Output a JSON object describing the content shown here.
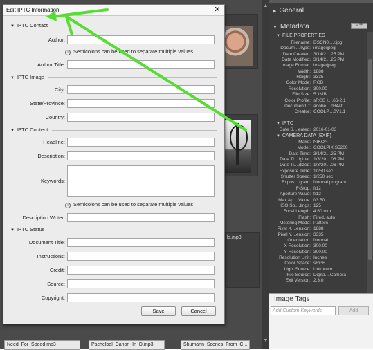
{
  "background": {
    "files": [
      "Need_For_Speed.mp3",
      "Pachelbel_Canon_In_D.mp3",
      "Shumann_Scenes_From_C..."
    ],
    "partial_file": "ls.mp3"
  },
  "panel": {
    "general_header": "General",
    "metadata_header": "Metadata",
    "file_properties_title": "FILE PROPERTIES",
    "file_properties": [
      {
        "k": "Filename:",
        "v": "DSCN0....r.jpg"
      },
      {
        "k": "Docum....Type:",
        "v": "image/jpeg"
      },
      {
        "k": "Date Created:",
        "v": "3/14/2....25 PM"
      },
      {
        "k": "Date Modified:",
        "v": "3/14/2....25 PM"
      },
      {
        "k": "Image Format:",
        "v": "image/jpeg"
      },
      {
        "k": "Width:",
        "v": "1888"
      },
      {
        "k": "Height:",
        "v": "3335"
      },
      {
        "k": "Color Mode:",
        "v": "RGB"
      },
      {
        "k": "Resolution:",
        "v": "300.00"
      },
      {
        "k": "File Size:",
        "v": "5.1MB"
      },
      {
        "k": "Color Profile:",
        "v": "sRGB I....66-2.1"
      },
      {
        "k": "DocumentID:",
        "v": "adobe....d844f"
      },
      {
        "k": "Creator:",
        "v": "COOLP....0V1.1"
      }
    ],
    "iptc_title": "IPTC",
    "iptc_rows": [
      {
        "k": "Date S....eated:",
        "v": "2016-01-03"
      }
    ],
    "camera_title": "CAMERA DATA (EXIF)",
    "camera_rows": [
      {
        "k": "Make:",
        "v": "NIKON"
      },
      {
        "k": "Model:",
        "v": "COOLPIX S5200"
      },
      {
        "k": "Date Time:",
        "v": "3/14/2....25 PM"
      },
      {
        "k": "Date Ti....iginal:",
        "v": "1/3/20....06 PM"
      },
      {
        "k": "Date Ti....itized:",
        "v": "1/3/20....06 PM"
      },
      {
        "k": "Exposure Time:",
        "v": "1/250 sec"
      },
      {
        "k": "Shutter Speed:",
        "v": "1/250 sec"
      },
      {
        "k": "Expos....gram:",
        "v": "Normal program"
      },
      {
        "k": "F-Stop:",
        "v": "f/12"
      },
      {
        "k": "Aperture Value:",
        "v": "f/12"
      },
      {
        "k": "Max Ap....Value:",
        "v": "f/3.50"
      },
      {
        "k": "ISO Sp....tings:",
        "v": "125"
      },
      {
        "k": "Focal Length:",
        "v": "4.60 mm"
      },
      {
        "k": "Flash:",
        "v": "Fired, auto"
      },
      {
        "k": "Metering Mode:",
        "v": "Pattern"
      },
      {
        "k": "Pixel X....ension:",
        "v": "1888"
      },
      {
        "k": "Pixel Y....ension:",
        "v": "3335"
      },
      {
        "k": "Orientation:",
        "v": "Normal"
      },
      {
        "k": "X Resolution:",
        "v": "300.00"
      },
      {
        "k": "Y Resolution:",
        "v": "300.00"
      },
      {
        "k": "Resolution Unit:",
        "v": "Inches"
      },
      {
        "k": "Color Space:",
        "v": "sRGB"
      },
      {
        "k": "Light Source:",
        "v": "Unknown"
      },
      {
        "k": "File Source:",
        "v": "Digita....Camera"
      },
      {
        "k": "Exif Version:",
        "v": "2.3.0"
      }
    ],
    "image_tags_title": "Image Tags",
    "tags_placeholder": "Add Custom Keywords",
    "tags_add": "Add"
  },
  "dialog": {
    "title": "Edit IPTC Information",
    "close": "✕",
    "sections": {
      "contact": "IPTC Contact",
      "image": "IPTC Image",
      "content": "IPTC Content",
      "status": "IPTC Status"
    },
    "labels": {
      "author": "Author:",
      "author_title": "Author Title:",
      "city": "City:",
      "state": "State/Province:",
      "country": "Country:",
      "headline": "Headline:",
      "description": "Description:",
      "keywords": "Keywords:",
      "description_writer": "Description Writer:",
      "document_title": "Document Title:",
      "instructions": "Instructions:",
      "credit": "Credit:",
      "source": "Source:",
      "copyright": "Copyright:"
    },
    "hint": "Semicolons can be used to separate multiple values",
    "save": "Save",
    "cancel": "Cancel"
  },
  "colors": {
    "arrow": "#55dd33",
    "panel_bg": "#3c3c3c",
    "dialog_bg": "#ececec"
  }
}
